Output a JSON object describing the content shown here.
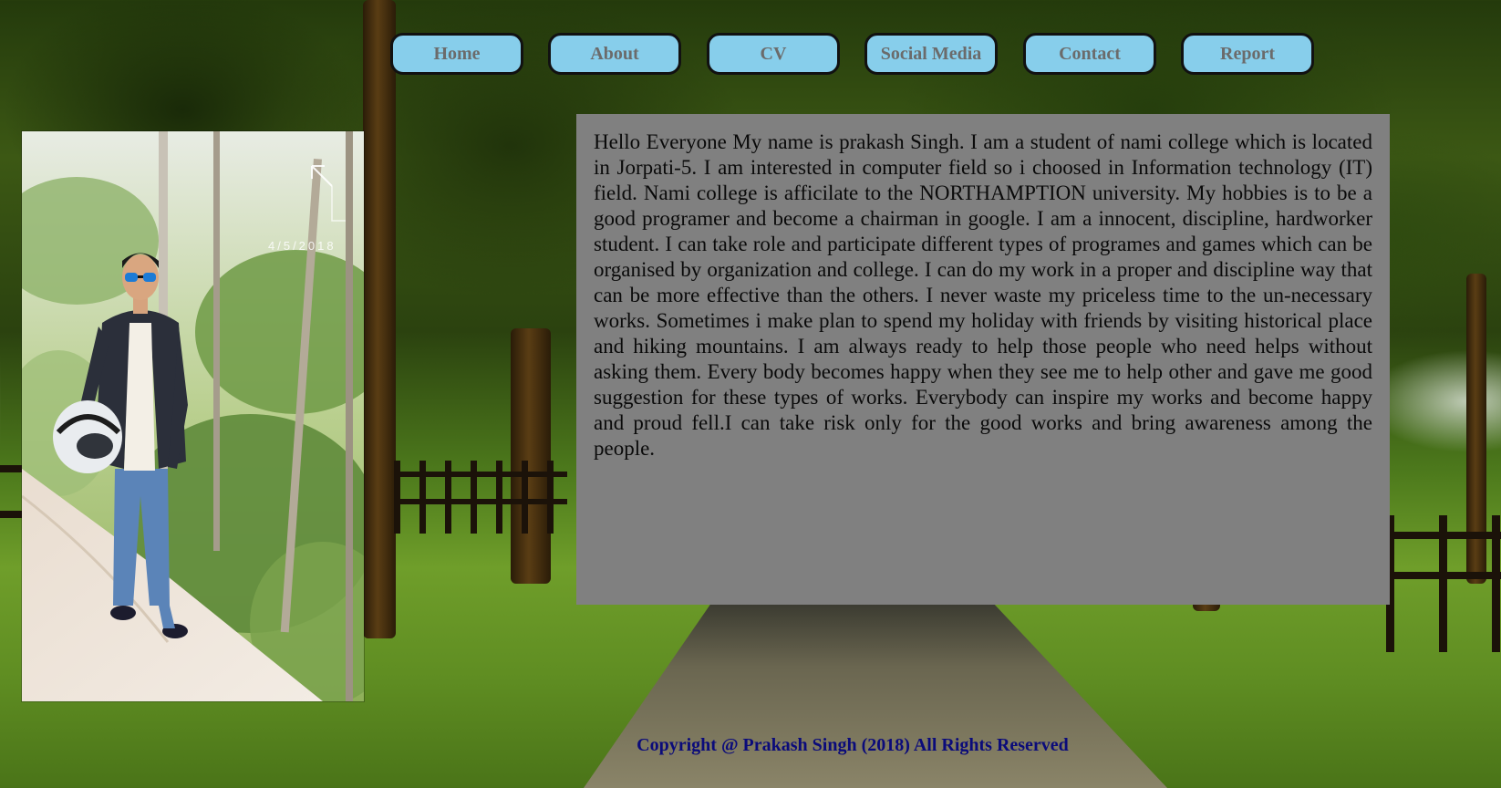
{
  "nav": {
    "items": [
      {
        "label": "Home"
      },
      {
        "label": "About"
      },
      {
        "label": "CV"
      },
      {
        "label": "Social Media"
      },
      {
        "label": "Contact"
      },
      {
        "label": "Report"
      }
    ],
    "button_color": "#87ceeb",
    "text_color": "#6b6b6b"
  },
  "profile_photo": {
    "date_stamp": "4/5/2018"
  },
  "about": {
    "paragraph": "Hello Everyone My name is prakash Singh. I am a student of nami college which is located in Jorpati-5. I am interested in computer field so i choosed in Information technology (IT) field. Nami college is afficilate to the NORTHAMPTION university. My hobbies is to be a good programer and become a chairman in google. I am a innocent, discipline, hardworker student. I can take role and participate different types of programes and games which can be organised by organization and college. I can do my work in a proper and discipline way that can be more effective than the others. I never waste my priceless time to the un-necessary works. Sometimes i make plan to spend my holiday with friends by visiting historical place and hiking mountains. I am always ready to help those people who need helps without asking them. Every body becomes happy when they see me to help other and gave me good suggestion for these types of works. Everybody can inspire my works and become happy and proud fell.I can take risk only for the good works and bring awareness among the people.",
    "panel_color": "#808080"
  },
  "footer": {
    "copyright": "Copyright @ Prakash Singh (2018) All Rights Reserved",
    "color": "#0b0b7a"
  }
}
